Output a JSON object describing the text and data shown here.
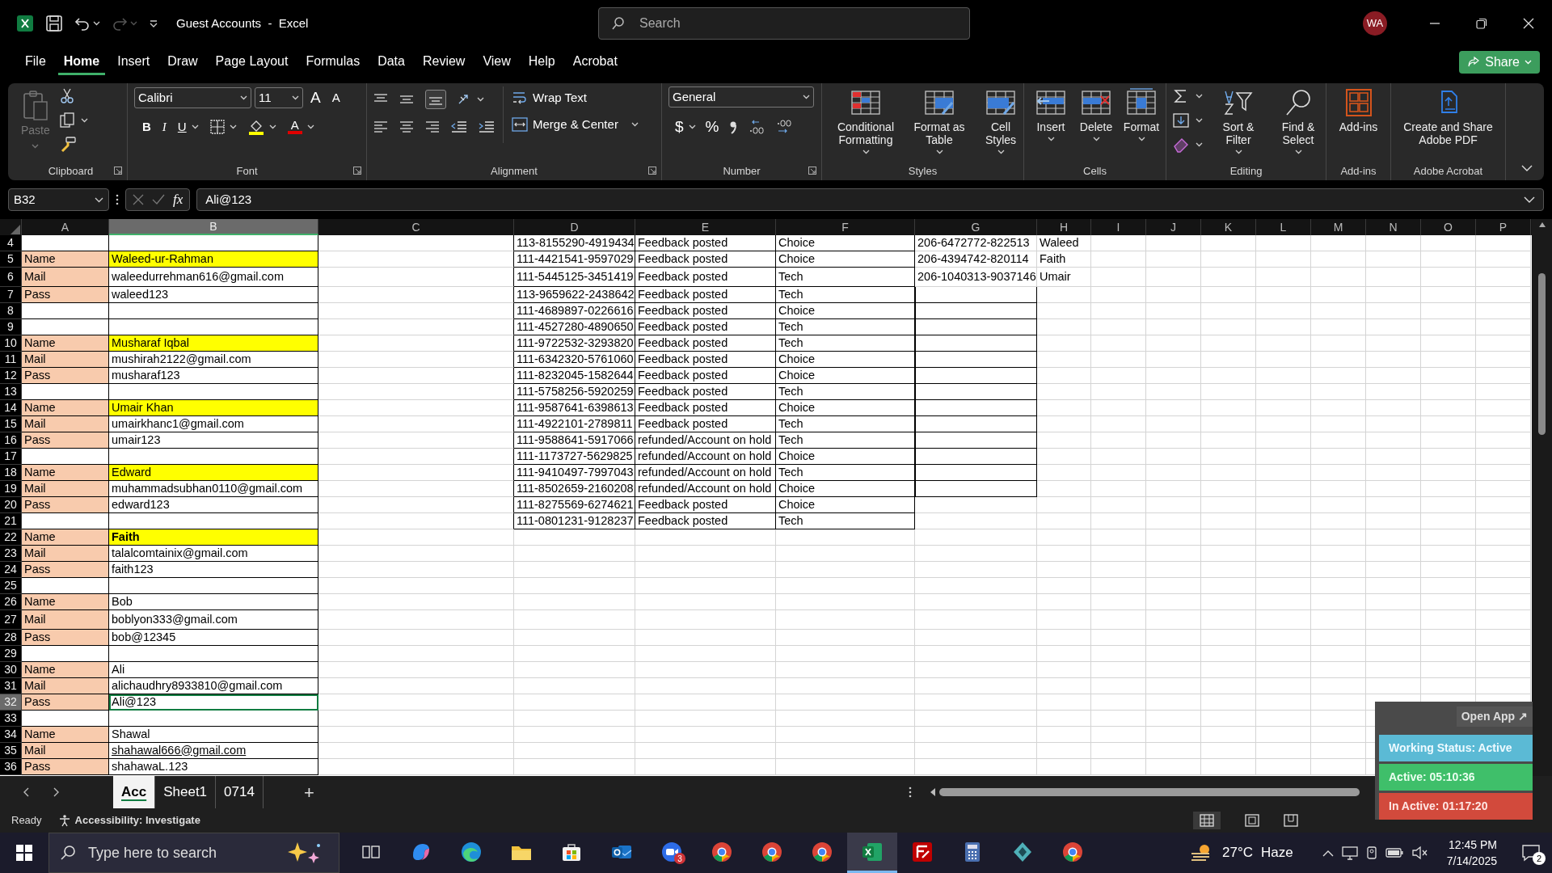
{
  "title_bar": {
    "app_title": "Guest Accounts  -  Excel",
    "search_placeholder": "Search",
    "avatar": "WA",
    "redo_disabled": true
  },
  "menu_tabs": [
    {
      "label": "File",
      "selected": false
    },
    {
      "label": "Home",
      "selected": true
    },
    {
      "label": "Insert",
      "selected": false
    },
    {
      "label": "Draw",
      "selected": false
    },
    {
      "label": "Page Layout",
      "selected": false
    },
    {
      "label": "Formulas",
      "selected": false
    },
    {
      "label": "Data",
      "selected": false
    },
    {
      "label": "Review",
      "selected": false
    },
    {
      "label": "View",
      "selected": false
    },
    {
      "label": "Help",
      "selected": false
    },
    {
      "label": "Acrobat",
      "selected": false
    }
  ],
  "share": "Share",
  "ribbon": {
    "clipboard": {
      "label": "Clipboard",
      "paste": "Paste",
      "paste_disabled": true
    },
    "font": {
      "label": "Font",
      "family": "Calibri",
      "size": "11",
      "grow": "A",
      "shrink": "A",
      "bold": "B",
      "italic": "I",
      "underline": "U",
      "color_letter": "A"
    },
    "alignment": {
      "label": "Alignment",
      "wrap_text": "Wrap Text",
      "merge_center": "Merge & Center"
    },
    "number": {
      "label": "Number",
      "format": "General",
      "currency": "$",
      "percent": "%"
    },
    "styles": {
      "label": "Styles",
      "buttons": [
        "Conditional Formatting",
        "Format as Table",
        "Cell Styles"
      ]
    },
    "cells": {
      "label": "Cells",
      "buttons": [
        "Insert",
        "Delete",
        "Format"
      ]
    },
    "editing": {
      "label": "Editing",
      "buttons": [
        "Sort & Filter",
        "Find & Select"
      ]
    },
    "add_ins": {
      "label": "Add-ins",
      "button": "Add-ins"
    },
    "adobe": {
      "label": "Adobe Acrobat",
      "button": "Create and Share Adobe PDF"
    }
  },
  "formula_bar": {
    "name_box": "B32",
    "fx": "fx",
    "value": "Ali@123"
  },
  "columns": [
    {
      "label": "A",
      "selected": false
    },
    {
      "label": "B",
      "selected": true
    },
    {
      "label": "C",
      "selected": false
    },
    {
      "label": "D",
      "selected": false
    },
    {
      "label": "E",
      "selected": false
    },
    {
      "label": "F",
      "selected": false
    },
    {
      "label": "G",
      "selected": false
    },
    {
      "label": "H",
      "selected": false
    },
    {
      "label": "I",
      "selected": false
    },
    {
      "label": "J",
      "selected": false
    },
    {
      "label": "K",
      "selected": false
    },
    {
      "label": "L",
      "selected": false
    },
    {
      "label": "M",
      "selected": false
    },
    {
      "label": "N",
      "selected": false
    },
    {
      "label": "O",
      "selected": false
    },
    {
      "label": "P",
      "selected": false
    }
  ],
  "rows": [
    {
      "row": "4",
      "kind": "plain",
      "selected": false,
      "d": "113-8155290-4919434",
      "e": "Feedback posted",
      "f": "Choice",
      "g": "206-6472772-822513",
      "h": "Waleed",
      "g_border": false
    },
    {
      "row": "5",
      "a": "Name",
      "b": "Waleed-ur-Rahman",
      "kind": "highlight",
      "selected": false,
      "d": "111-4421541-9597029",
      "e": "Feedback posted",
      "f": "Choice",
      "g": "206-4394742-820114",
      "h": "Faith",
      "g_border": false
    },
    {
      "row": "6",
      "a": "Mail",
      "b": "waleedurrehman616@gmail.com",
      "kind": "plain",
      "selected": false,
      "d": "111-5445125-3451419",
      "e": "Feedback posted",
      "f": "Tech",
      "g": "206-1040313-9037146",
      "h": "Umair",
      "g_border": false
    },
    {
      "row": "7",
      "a": "Pass",
      "b": "waleed123",
      "kind": "plain",
      "selected": false,
      "d": "113-9659622-2438642",
      "e": "Feedback posted",
      "f": "Tech",
      "g_border": true
    },
    {
      "row": "8",
      "kind": "plain",
      "selected": false,
      "d": "111-4689897-0226616",
      "e": "Feedback posted",
      "f": "Choice",
      "g_border": true
    },
    {
      "row": "9",
      "kind": "plain",
      "selected": false,
      "d": "111-4527280-4890650",
      "e": "Feedback posted",
      "f": "Tech",
      "g_border": true
    },
    {
      "row": "10",
      "a": "Name",
      "b": "Musharaf Iqbal",
      "kind": "highlight",
      "selected": false,
      "d": "111-9722532-3293820",
      "e": "Feedback posted",
      "f": "Tech",
      "g_border": true
    },
    {
      "row": "11",
      "a": "Mail",
      "b": "mushirah2122@gmail.com",
      "kind": "plain",
      "selected": false,
      "d": "111-6342320-5761060",
      "e": "Feedback posted",
      "f": "Choice",
      "g_border": true
    },
    {
      "row": "12",
      "a": "Pass",
      "b": "musharaf123",
      "kind": "plain",
      "selected": false,
      "d": "111-8232045-1582644",
      "e": "Feedback posted",
      "f": "Choice",
      "g_border": true
    },
    {
      "row": "13",
      "kind": "plain",
      "selected": false,
      "d": "111-5758256-5920259",
      "e": "Feedback posted",
      "f": "Tech",
      "g_border": true
    },
    {
      "row": "14",
      "a": "Name",
      "b": "Umair Khan",
      "kind": "highlight",
      "selected": false,
      "d": "111-9587641-6398613",
      "e": "Feedback posted",
      "f": "Choice",
      "g_border": true
    },
    {
      "row": "15",
      "a": "Mail",
      "b": "umairkhanc1@gmail.com",
      "kind": "plain",
      "selected": false,
      "d": "111-4922101-2789811",
      "e": "Feedback posted",
      "f": "Tech",
      "g_border": true
    },
    {
      "row": "16",
      "a": "Pass",
      "b": "umair123",
      "kind": "plain",
      "selected": false,
      "d": "111-9588641-5917066",
      "e": "refunded/Account on hold",
      "f": "Tech",
      "g_border": true
    },
    {
      "row": "17",
      "kind": "plain",
      "selected": false,
      "d": "111-1173727-5629825",
      "e": "refunded/Account on hold",
      "f": "Choice",
      "g_border": true
    },
    {
      "row": "18",
      "a": "Name",
      "b": "Edward",
      "kind": "highlight",
      "selected": false,
      "d": "111-9410497-7997043",
      "e": "refunded/Account on hold",
      "f": "Tech",
      "g_border": true
    },
    {
      "row": "19",
      "a": "Mail",
      "b": "muhammadsubhan0110@gmail.com",
      "kind": "plain",
      "selected": false,
      "d": "111-8502659-2160208",
      "e": "refunded/Account on hold",
      "f": "Choice",
      "g_border": true
    },
    {
      "row": "20",
      "a": "Pass",
      "b": "edward123",
      "kind": "plain",
      "selected": false,
      "d": "111-8275569-6274621",
      "e": "Feedback posted",
      "f": "Choice",
      "g_border": false
    },
    {
      "row": "21",
      "kind": "plain",
      "selected": false,
      "d": "111-0801231-9128237",
      "e": "Feedback posted",
      "f": "Tech",
      "g_border": false
    },
    {
      "row": "22",
      "a": "Name",
      "b": "Faith",
      "kind": "highlight_bold",
      "selected": false,
      "g_border": false
    },
    {
      "row": "23",
      "a": "Mail",
      "b": "talalcomtainix@gmail.com",
      "kind": "plain",
      "selected": false,
      "g_border": false
    },
    {
      "row": "24",
      "a": "Pass",
      "b": "faith123",
      "kind": "plain",
      "selected": false,
      "g_border": false
    },
    {
      "row": "25",
      "kind": "plain",
      "selected": false,
      "g_border": false
    },
    {
      "row": "26",
      "a": "Name",
      "b": "Bob",
      "kind": "plain",
      "selected": false,
      "g_border": false
    },
    {
      "row": "27",
      "a": "Mail",
      "b": "boblyon333@gmail.com",
      "kind": "plain",
      "selected": false,
      "g_border": false
    },
    {
      "row": "28",
      "a": "Pass",
      "b": "bob@12345",
      "kind": "plain",
      "selected": false,
      "g_border": false
    },
    {
      "row": "29",
      "kind": "plain",
      "selected": false,
      "g_border": false
    },
    {
      "row": "30",
      "a": "Name",
      "b": "Ali",
      "kind": "plain",
      "selected": false,
      "g_border": false
    },
    {
      "row": "31",
      "a": "Mail",
      "b": "alichaudhry8933810@gmail.com",
      "kind": "plain",
      "selected": false,
      "g_border": false
    },
    {
      "row": "32",
      "a": "Pass",
      "b": "Ali@123",
      "kind": "plain",
      "selected": true,
      "g_border": false
    },
    {
      "row": "33",
      "kind": "plain",
      "selected": false,
      "g_border": false
    },
    {
      "row": "34",
      "a": "Name",
      "b": "Shawal",
      "kind": "plain",
      "selected": false,
      "g_border": false
    },
    {
      "row": "35",
      "a": "Mail",
      "b": "shahawal666@gmail.com",
      "kind": "link",
      "selected": false,
      "g_border": false
    },
    {
      "row": "36",
      "a": "Pass",
      "b": "shahawaL.123",
      "kind": "plain",
      "selected": false,
      "g_border": false
    }
  ],
  "sheet_tabs": [
    {
      "label": "Acc",
      "selected": true
    },
    {
      "label": "Sheet1",
      "selected": false
    },
    {
      "label": "0714",
      "selected": false
    }
  ],
  "add_sheet": "+",
  "status_bar": {
    "ready": "Ready",
    "accessibility": "Accessibility: Investigate"
  },
  "tracker_widget": {
    "open_app": "Open App ↗",
    "working_status": "Working Status: Active",
    "active": "Active: 05:10:36",
    "inactive": "In Active: 01:17:20"
  },
  "taskbar": {
    "search_placeholder": "Type here to search",
    "apps": [
      {
        "kind": "taskview",
        "selected": false
      },
      {
        "kind": "copilot",
        "selected": false
      },
      {
        "kind": "edge",
        "selected": false
      },
      {
        "kind": "explorer",
        "selected": false
      },
      {
        "kind": "store",
        "selected": false
      },
      {
        "kind": "outlook",
        "selected": false
      },
      {
        "kind": "zoom",
        "selected": false,
        "badge": "3"
      },
      {
        "kind": "chrome",
        "selected": false
      },
      {
        "kind": "chrome",
        "selected": false
      },
      {
        "kind": "chrome",
        "selected": false
      },
      {
        "kind": "excel",
        "selected": true
      },
      {
        "kind": "filezilla",
        "selected": false
      },
      {
        "kind": "calculator",
        "selected": false
      },
      {
        "kind": "gem",
        "selected": false
      },
      {
        "kind": "chrome",
        "selected": false
      }
    ],
    "weather_temp": "27°C",
    "weather_text": "Haze",
    "time": "12:45 PM",
    "date": "7/14/2025",
    "notifications": "2"
  }
}
